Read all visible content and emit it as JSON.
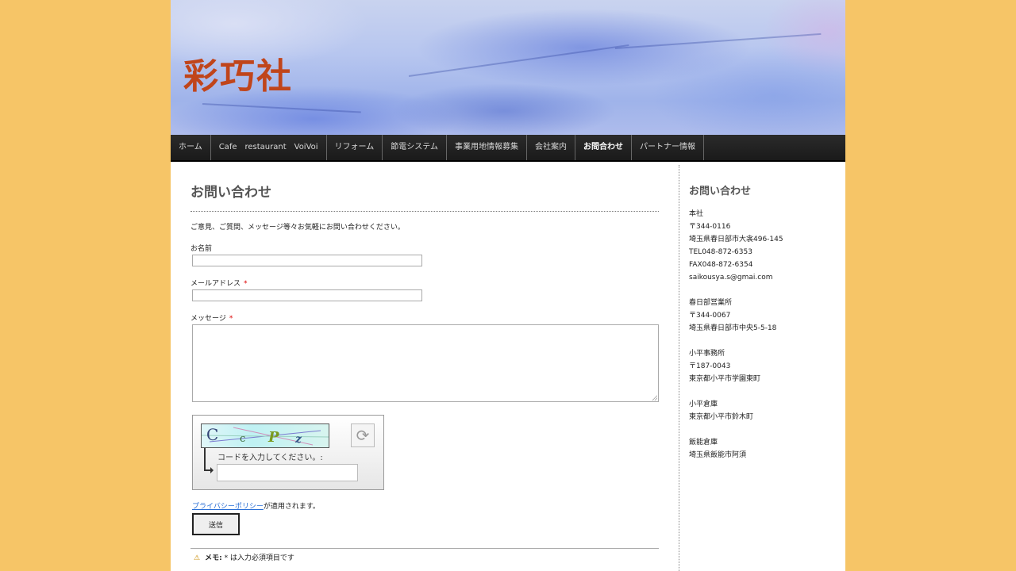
{
  "site": {
    "logo": "彩巧社"
  },
  "nav": {
    "items": [
      {
        "label": "ホーム",
        "active": false
      },
      {
        "label": "Cafe　restaurant　VoiVoi",
        "active": false
      },
      {
        "label": "リフォーム",
        "active": false
      },
      {
        "label": "節電システム",
        "active": false
      },
      {
        "label": "事業用地情報募集",
        "active": false
      },
      {
        "label": "会社案内",
        "active": false
      },
      {
        "label": "お問合わせ",
        "active": true
      },
      {
        "label": "パートナー情報",
        "active": false
      }
    ]
  },
  "main": {
    "title": "お問い合わせ",
    "intro": "ご意見、ご質問、メッセージ等々お気軽にお問い合わせください。",
    "name_label": "お名前",
    "email_label": "メールアドレス",
    "message_label": "メッセージ",
    "required_mark": "*",
    "name_value": "",
    "email_value": "",
    "message_value": ""
  },
  "captcha": {
    "code_text": "C c P z",
    "label": "コードを入力してください。:",
    "input_value": ""
  },
  "privacy": {
    "link": "プライバシーポリシー",
    "suffix": "が適用されます。"
  },
  "submit_label": "送信",
  "memo": {
    "label": "メモ:",
    "text": "* は入力必須項目です"
  },
  "sidebar": {
    "title": "お問い合わせ",
    "lines": [
      "本社",
      "〒344-0116",
      "埼玉県春日部市大衾496-145",
      "TEL048-872-6353",
      "FAX048-872-6354",
      "saikousya.s@gmai.com",
      "",
      " 春日部営業所",
      " 〒344-0067",
      "埼玉県春日部市中央5-5-18",
      "",
      " 小平事務所",
      "〒187-0043",
      "東京都小平市学園東町",
      "",
      "小平倉庫",
      "東京都小平市鈴木町",
      "",
      "飯能倉庫",
      "埼玉県飯能市阿須"
    ]
  },
  "colors": {
    "background": "#f6c567",
    "logo": "#c0451b",
    "nav_bg": "#222222",
    "link": "#2a6fd6",
    "required": "#dd0000"
  }
}
